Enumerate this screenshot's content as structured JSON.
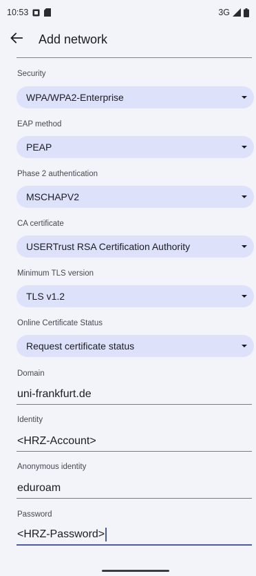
{
  "status_bar": {
    "time": "10:53",
    "network": "3G",
    "icons": [
      "notification-icon",
      "sim-card-icon",
      "signal-icon",
      "battery-icon"
    ]
  },
  "app_bar": {
    "title": "Add network",
    "back_icon": "arrow-back-icon"
  },
  "fields": {
    "security": {
      "label": "Security",
      "value": "WPA/WPA2-Enterprise"
    },
    "eap_method": {
      "label": "EAP method",
      "value": "PEAP"
    },
    "phase2": {
      "label": "Phase 2 authentication",
      "value": "MSCHAPV2"
    },
    "ca_cert": {
      "label": "CA certificate",
      "value": "USERTrust RSA Certification Authority"
    },
    "min_tls": {
      "label": "Minimum TLS version",
      "value": "TLS v1.2"
    },
    "ocsp": {
      "label": "Online Certificate Status",
      "value": "Request certificate status"
    },
    "domain": {
      "label": "Domain",
      "value": "uni-frankfurt.de"
    },
    "identity": {
      "label": "Identity",
      "value": "<HRZ-Account>"
    },
    "anon_identity": {
      "label": "Anonymous identity",
      "value": "eduroam"
    },
    "password": {
      "label": "Password",
      "value": "<HRZ-Password>"
    }
  },
  "colors": {
    "background": "#f3f4f9",
    "dropdown_fill": "#dee1fa",
    "focus_accent": "#4c5a9e"
  }
}
